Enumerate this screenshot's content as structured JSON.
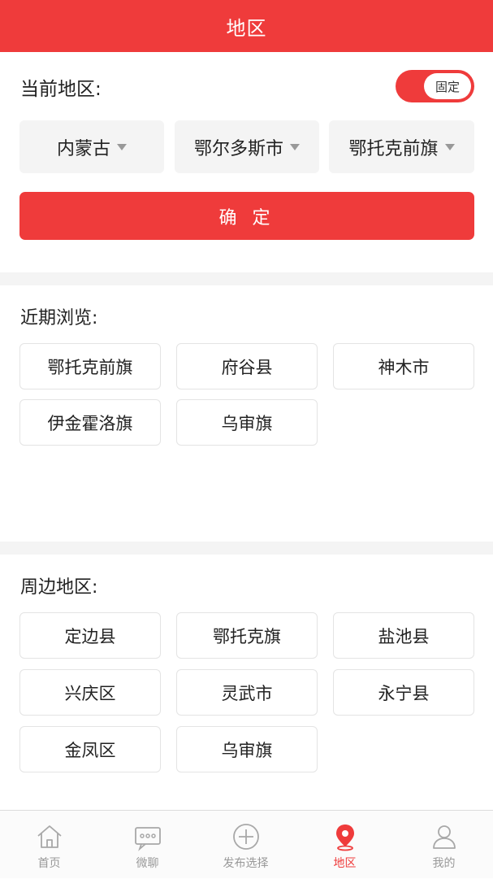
{
  "header": {
    "title": "地区"
  },
  "current": {
    "label": "当前地区:",
    "toggle_label": "固定",
    "selects": [
      {
        "value": "内蒙古"
      },
      {
        "value": "鄂尔多斯市"
      },
      {
        "value": "鄂托克前旗"
      }
    ],
    "confirm_label": "确 定"
  },
  "recent": {
    "title": "近期浏览:",
    "items": [
      "鄂托克前旗",
      "府谷县",
      "神木市",
      "伊金霍洛旗",
      "乌审旗"
    ]
  },
  "nearby": {
    "title": "周边地区:",
    "items": [
      "定边县",
      "鄂托克旗",
      "盐池县",
      "兴庆区",
      "灵武市",
      "永宁县",
      "金凤区",
      "乌审旗"
    ]
  },
  "tabbar": {
    "items": [
      {
        "label": "首页",
        "icon": "home-icon",
        "active": false
      },
      {
        "label": "微聊",
        "icon": "chat-icon",
        "active": false
      },
      {
        "label": "发布选择",
        "icon": "plus-circle-icon",
        "active": false
      },
      {
        "label": "地区",
        "icon": "location-pin-icon",
        "active": true
      },
      {
        "label": "我的",
        "icon": "user-icon",
        "active": false
      }
    ]
  },
  "colors": {
    "accent": "#ef3b3b",
    "inactive": "#999999",
    "gap": "#f4f4f4"
  }
}
